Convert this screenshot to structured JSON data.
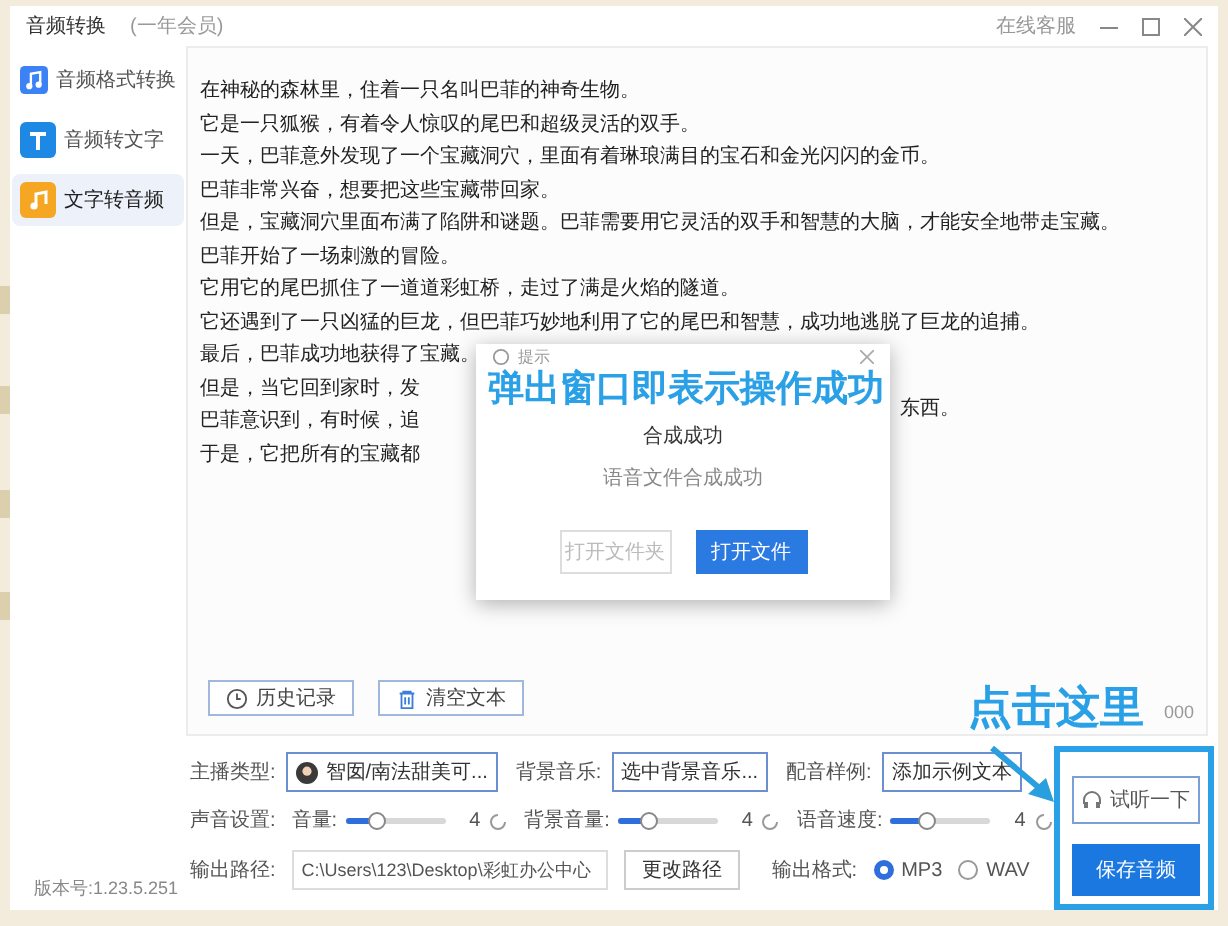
{
  "window": {
    "title": "音频转换",
    "membership": "(一年会员)",
    "service_link": "在线客服"
  },
  "sidebar": {
    "items": [
      {
        "label": "音频格式转换",
        "kind": "convert",
        "selected": false
      },
      {
        "label": "音频转文字",
        "kind": "transcribe",
        "selected": false
      },
      {
        "label": "文字转音频",
        "kind": "synthesize",
        "selected": true
      }
    ]
  },
  "editor": {
    "lines": [
      {
        "text": "在神秘的森林里，住着一只名叫巴菲的神奇生物。"
      },
      {
        "text": "它是一只狐猴，有着令人惊叹的尾巴和超级灵活的双手。"
      },
      {
        "text": "一天，巴菲意外发现了一个宝藏洞穴，里面有着琳琅满目的宝石和金光闪闪的金币。"
      },
      {
        "text": "巴菲非常兴奋，想要把这些宝藏带回家。"
      },
      {
        "text": "但是，宝藏洞穴里面布满了陷阱和谜题。巴菲需要用它灵活的双手和智慧的大脑，才能安全地带走宝藏。"
      },
      {
        "text": "巴菲开始了一场刺激的冒险。"
      },
      {
        "text": "它用它的尾巴抓住了一道道彩虹桥，走过了满是火焰的隧道。"
      },
      {
        "text": "它还遇到了一只凶猛的巨龙，但巴菲巧妙地利用了它的尾巴和智慧，成功地逃脱了巨龙的追捕。"
      },
      {
        "text": "最后，巴菲成功地获得了宝藏。"
      },
      {
        "text": "但是，当它回到家时，发"
      },
      {
        "text": "巴菲意识到，有时候，追",
        "tail": "东西。"
      },
      {
        "text": "于是，它把所有的宝藏都"
      }
    ],
    "buttons": [
      {
        "label": "历史记录",
        "kind": "history"
      },
      {
        "label": "清空文本",
        "kind": "clear"
      }
    ],
    "counter": "000"
  },
  "dialog": {
    "title": "提示",
    "heading": "合成成功",
    "message": "语音文件合成成功",
    "buttons": [
      {
        "label": "打开文件夹",
        "primary": false
      },
      {
        "label": "打开文件",
        "primary": true
      }
    ]
  },
  "settings": {
    "anchor_label": "主播类型:",
    "anchor_value": "智囡/南法甜美可...",
    "music_label": "背景音乐:",
    "music_value": "选中背景音乐...",
    "sample_label": "配音样例:",
    "sample_button": "添加示例文本",
    "sound_label": "声音设置:",
    "sliders": [
      {
        "label": "音量:",
        "level": 0.3,
        "value": "4"
      },
      {
        "label": "背景音量:",
        "level": 0.3,
        "value": "4"
      },
      {
        "label": "语音速度:",
        "level": 0.35,
        "value": "4"
      }
    ],
    "path_label": "输出路径:",
    "path_value": "C:\\Users\\123\\Desktop\\彩虹办公中心",
    "path_button": "更改路径",
    "format_label": "输出格式:",
    "formats": [
      {
        "label": "MP3",
        "selected": true
      },
      {
        "label": "WAV",
        "selected": false
      }
    ]
  },
  "actions": {
    "preview": "试听一下",
    "save": "保存音频"
  },
  "version": "版本号:1.23.5.251",
  "annotations": [
    {
      "text": "弹出窗口即表示操作成功"
    },
    {
      "text": "点击这里"
    }
  ]
}
